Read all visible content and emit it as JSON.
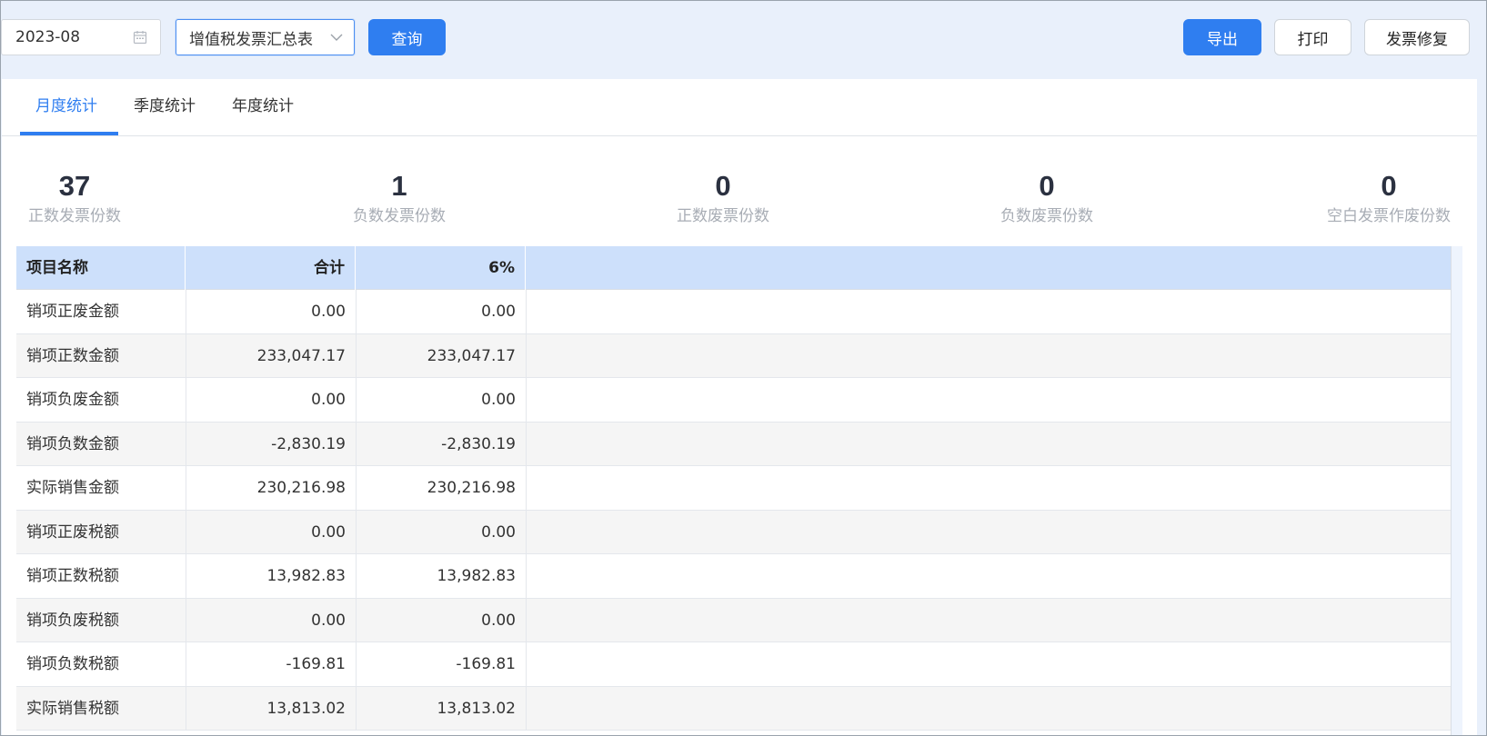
{
  "toolbar": {
    "date_value": "2023-08",
    "report_select": "增值税发票汇总表",
    "query_label": "查询",
    "export_label": "导出",
    "print_label": "打印",
    "repair_label": "发票修复"
  },
  "tabs": [
    {
      "label": "月度统计",
      "active": true
    },
    {
      "label": "季度统计",
      "active": false
    },
    {
      "label": "年度统计",
      "active": false
    }
  ],
  "stats": [
    {
      "value": "37",
      "label": "正数发票份数"
    },
    {
      "value": "1",
      "label": "负数发票份数"
    },
    {
      "value": "0",
      "label": "正数废票份数"
    },
    {
      "value": "0",
      "label": "负数废票份数"
    },
    {
      "value": "0",
      "label": "空白发票作废份数"
    }
  ],
  "table": {
    "headers": [
      "项目名称",
      "合计",
      "6%"
    ],
    "rows": [
      [
        "销项正废金额",
        "0.00",
        "0.00"
      ],
      [
        "销项正数金额",
        "233,047.17",
        "233,047.17"
      ],
      [
        "销项负废金额",
        "0.00",
        "0.00"
      ],
      [
        "销项负数金额",
        "-2,830.19",
        "-2,830.19"
      ],
      [
        "实际销售金额",
        "230,216.98",
        "230,216.98"
      ],
      [
        "销项正废税额",
        "0.00",
        "0.00"
      ],
      [
        "销项正数税额",
        "13,982.83",
        "13,982.83"
      ],
      [
        "销项负废税额",
        "0.00",
        "0.00"
      ],
      [
        "销项负数税额",
        "-169.81",
        "-169.81"
      ],
      [
        "实际销售税额",
        "13,813.02",
        "13,813.02"
      ]
    ]
  },
  "colors": {
    "primary": "#2f7ef0",
    "header_bg": "#cde0fb",
    "page_bg": "#e9f0fb"
  },
  "icons": {
    "date": "calendar-icon",
    "select": "chevron-down-icon"
  }
}
